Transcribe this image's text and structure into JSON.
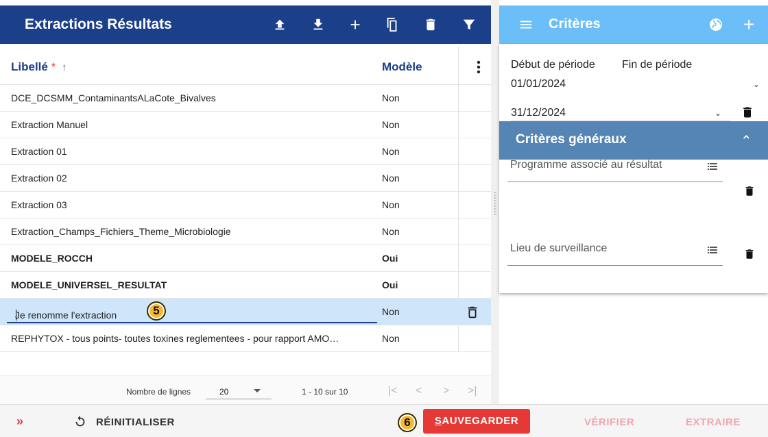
{
  "left_panel": {
    "title": "Extractions Résultats",
    "toolbar_icons": [
      "upload-icon",
      "download-icon",
      "add-icon",
      "copy-icon",
      "delete-icon",
      "filter-icon"
    ],
    "columns": {
      "libelle": "Libellé",
      "required_mark": "*",
      "sort_arrow": "↑",
      "modele": "Modèle"
    },
    "rows": [
      {
        "libelle": "DCE_DCSMM_ContaminantsALaCote_Bivalves",
        "modele": "Non"
      },
      {
        "libelle": "Extraction Manuel",
        "modele": "Non"
      },
      {
        "libelle": "Extraction 01",
        "modele": "Non"
      },
      {
        "libelle": "Extraction 02",
        "modele": "Non"
      },
      {
        "libelle": "Extraction 03",
        "modele": "Non"
      },
      {
        "libelle": "Extraction_Champs_Fichiers_Theme_Microbiologie",
        "modele": "Non"
      },
      {
        "libelle": "MODELE_ROCCH",
        "modele": "Oui"
      },
      {
        "libelle": "MODELE_UNIVERSEL_RESULTAT",
        "modele": "Oui"
      },
      {
        "libelle": "Je renomme l'extraction",
        "modele": "Non"
      },
      {
        "libelle": "REPHYTOX - tous points- toutes toxines reglementees - pour rapport AMO…",
        "modele": "Non"
      }
    ],
    "badge_5": "5",
    "paginator": {
      "label": "Nombre de lignes",
      "page_size": "20",
      "range": "1 - 10 sur 10"
    }
  },
  "right_panel": {
    "title": "Critères",
    "period": {
      "debut_label": "Début de période",
      "fin_label": "Fin de période",
      "debut_value": "01/01/2024",
      "fin_value": "31/12/2024"
    },
    "general": {
      "title": "Critères généraux",
      "fields": [
        "Programme associé au résultat",
        "Lieu de surveillance"
      ]
    }
  },
  "footer": {
    "expand": "»",
    "reset": "RÉINITIALISER",
    "badge_6": "6",
    "save_first": "S",
    "save_rest": "AUVEGARDER",
    "verify": "VÉRIFIER",
    "extract": "EXTRAIRE"
  },
  "colors": {
    "primary": "#1c3f8a",
    "accent": "#6bbef7",
    "section": "#5585b5",
    "danger": "#e53935",
    "selected_row": "#cfe5f9",
    "badge": "#f5b82e"
  }
}
